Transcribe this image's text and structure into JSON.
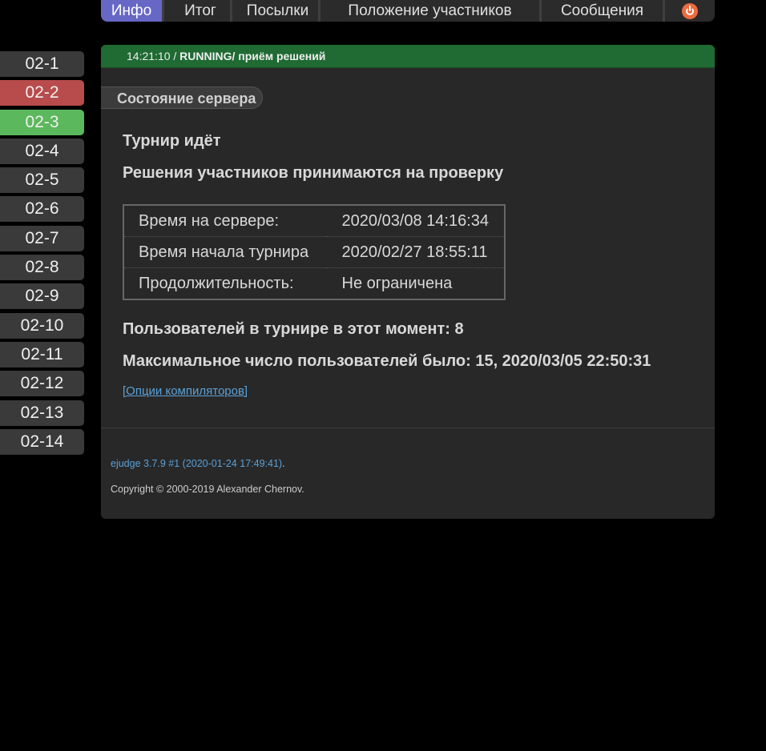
{
  "nav": {
    "tabs": [
      "Инфо",
      "Итог",
      "Посылки",
      "Положение участников",
      "Сообщения"
    ],
    "logout_icon": "power-icon",
    "accent": "#6767c6"
  },
  "problems": [
    "02-1",
    "02-2",
    "02-3",
    "02-4",
    "02-5",
    "02-6",
    "02-7",
    "02-8",
    "02-9",
    "02-10",
    "02-11",
    "02-12",
    "02-13",
    "02-14"
  ],
  "problem_status_colors": {
    "02-2": "#b84c4c",
    "02-3": "#5cb85c"
  },
  "status": {
    "time": "14:21:10 / ",
    "state": "RUNNING",
    "phase": "/ приём решений",
    "color": "#1f6b33"
  },
  "section_title": "Состояние сервера",
  "main": {
    "contest_state": "Турнир идёт",
    "submissions_state": "Решения участников принимаются на проверку",
    "table": [
      {
        "label": "Время на сервере:",
        "value": "2020/03/08 14:16:34"
      },
      {
        "label": "Время начала турнира",
        "value": "2020/02/27 18:55:11"
      },
      {
        "label": "Продолжительность:",
        "value": "Не ограничена"
      }
    ],
    "users_now": "Пользователей в турнире в этот момент: 8",
    "users_max": "Максимальное число пользователей было: 15, 2020/03/05 22:50:31",
    "compiler_link": "[Опции компиляторов]"
  },
  "footer": {
    "version": "ejudge 3.7.9 #1 (2020-01-24 17:49:41)",
    "version_suffix": ".",
    "copyright": "Copyright © 2000-2019 Alexander Chernov."
  }
}
